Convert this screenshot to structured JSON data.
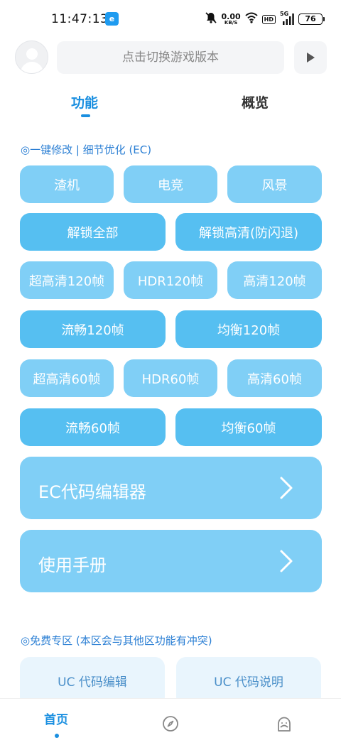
{
  "status_bar": {
    "time": "11:47:13",
    "app_icon_letter": "e",
    "net_speed_value": "0.00",
    "net_speed_unit": "KB/S",
    "hd_label": "HD",
    "signal_label": "5G",
    "battery": "76"
  },
  "header": {
    "version_placeholder": "点击切换游戏版本"
  },
  "tabs": [
    {
      "label": "功能",
      "active": true
    },
    {
      "label": "概览",
      "active": false
    }
  ],
  "section_one_key": {
    "title": "◎一键修改 | 细节优化 (EC)",
    "row1": [
      "渣机",
      "电竞",
      "风景"
    ],
    "row2": [
      "解锁全部",
      "解锁高清(防闪退)"
    ],
    "row3": [
      "超高清120帧",
      "HDR120帧",
      "高清120帧"
    ],
    "row4": [
      "流畅120帧",
      "均衡120帧"
    ],
    "row5": [
      "超高清60帧",
      "HDR60帧",
      "高清60帧"
    ],
    "row6": [
      "流畅60帧",
      "均衡60帧"
    ]
  },
  "cards": {
    "ec_editor": "EC代码编辑器",
    "manual": "使用手册"
  },
  "section_free": {
    "title": "◎免费专区 (本区会与其他区功能有冲突)",
    "items": [
      "UC 代码编辑",
      "UC 代码说明"
    ]
  },
  "bottom_nav": {
    "home": "首页"
  },
  "colors": {
    "accent": "#1a8fe0",
    "button_light": "#80cff6",
    "button_mid": "#56bff1",
    "free_card_bg": "#e9f5fd"
  }
}
